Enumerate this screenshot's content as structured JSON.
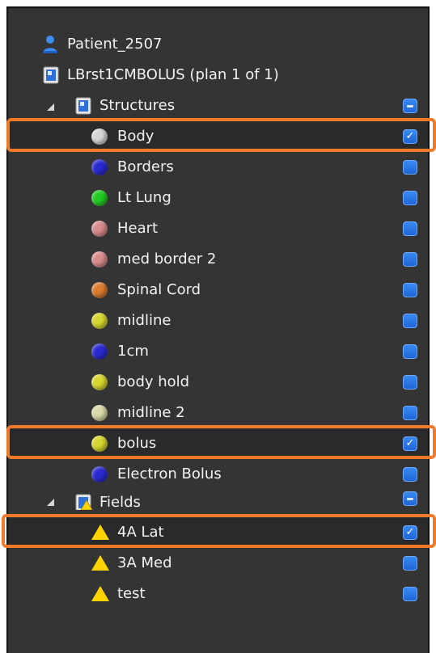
{
  "tree": {
    "patient": {
      "label": "Patient_2507",
      "icon": "patient-icon"
    },
    "plan": {
      "label": "LBrst1CMBOLUS (plan 1 of 1)",
      "icon": "plan-icon"
    },
    "structures": {
      "label": "Structures",
      "icon": "structure-set-icon",
      "items": [
        {
          "label": "Body",
          "color": "#d6d6d6",
          "checked": true
        },
        {
          "label": "Borders",
          "color": "#2a2ad0",
          "checked": false
        },
        {
          "label": "Lt Lung",
          "color": "#22cc22",
          "checked": false
        },
        {
          "label": "Heart",
          "color": "#d98c8c",
          "checked": false
        },
        {
          "label": "med border 2",
          "color": "#d98c8c",
          "checked": false
        },
        {
          "label": "Spinal Cord",
          "color": "#d97c30",
          "checked": false
        },
        {
          "label": "midline",
          "color": "#d6d630",
          "checked": false
        },
        {
          "label": "1cm",
          "color": "#2a2ad0",
          "checked": false
        },
        {
          "label": "body hold",
          "color": "#d6d630",
          "checked": false
        },
        {
          "label": "midline 2",
          "color": "#d8d8a8",
          "checked": false
        },
        {
          "label": "bolus",
          "color": "#d6d630",
          "checked": true
        },
        {
          "label": "Electron Bolus",
          "color": "#2a2ad0",
          "checked": false
        }
      ]
    },
    "fields": {
      "label": "Fields",
      "icon": "fields-icon",
      "items": [
        {
          "label": "4A Lat",
          "color": "#ffd400",
          "checked": true
        },
        {
          "label": "3A Med",
          "color": "#ffd400",
          "checked": false
        },
        {
          "label": "test",
          "color": "#ffd400",
          "checked": false
        }
      ]
    }
  },
  "colors": {
    "panel_bg": "#343434",
    "highlight": "#ee7a2a",
    "checkbox": "#2f7ae8"
  }
}
